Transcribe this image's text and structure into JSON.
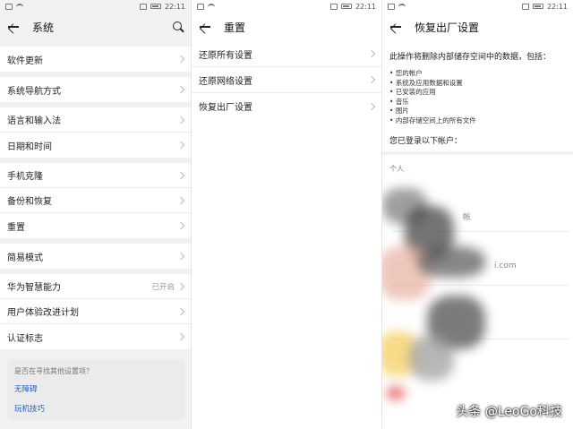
{
  "status": {
    "time": "22:11"
  },
  "panel1": {
    "title": "系统",
    "groups": [
      [
        {
          "label": "软件更新"
        }
      ],
      [
        {
          "label": "系统导航方式"
        }
      ],
      [
        {
          "label": "语言和输入法"
        },
        {
          "label": "日期和时间"
        }
      ],
      [
        {
          "label": "手机克隆"
        },
        {
          "label": "备份和恢复"
        },
        {
          "label": "重置"
        }
      ],
      [
        {
          "label": "简易模式"
        }
      ],
      [
        {
          "label": "华为智慧能力",
          "value": "已开启"
        },
        {
          "label": "用户体验改进计划"
        },
        {
          "label": "认证标志"
        }
      ]
    ],
    "suggest": {
      "question": "是否在寻找其他设置项？",
      "links": [
        "无障碍",
        "玩机技巧"
      ]
    }
  },
  "panel2": {
    "title": "重置",
    "items": [
      "还原所有设置",
      "还原网络设置",
      "恢复出厂设置"
    ]
  },
  "panel3": {
    "title": "恢复出厂设置",
    "intro": "此操作将删除内部储存空间中的数据，包括：",
    "list": [
      "您的帐户",
      "系统及应用数据和设置",
      "已安装的应用",
      "音乐",
      "图片",
      "内部存储空间上的所有文件"
    ],
    "logged_in": "您已登录以下帐户：",
    "account_section": "个人",
    "account_fragments": [
      "i.com",
      "帐"
    ]
  },
  "watermark": "头条 @LeoGo科技",
  "colors": {
    "link": "#1f5fd1",
    "background": "#f2f2f2"
  }
}
